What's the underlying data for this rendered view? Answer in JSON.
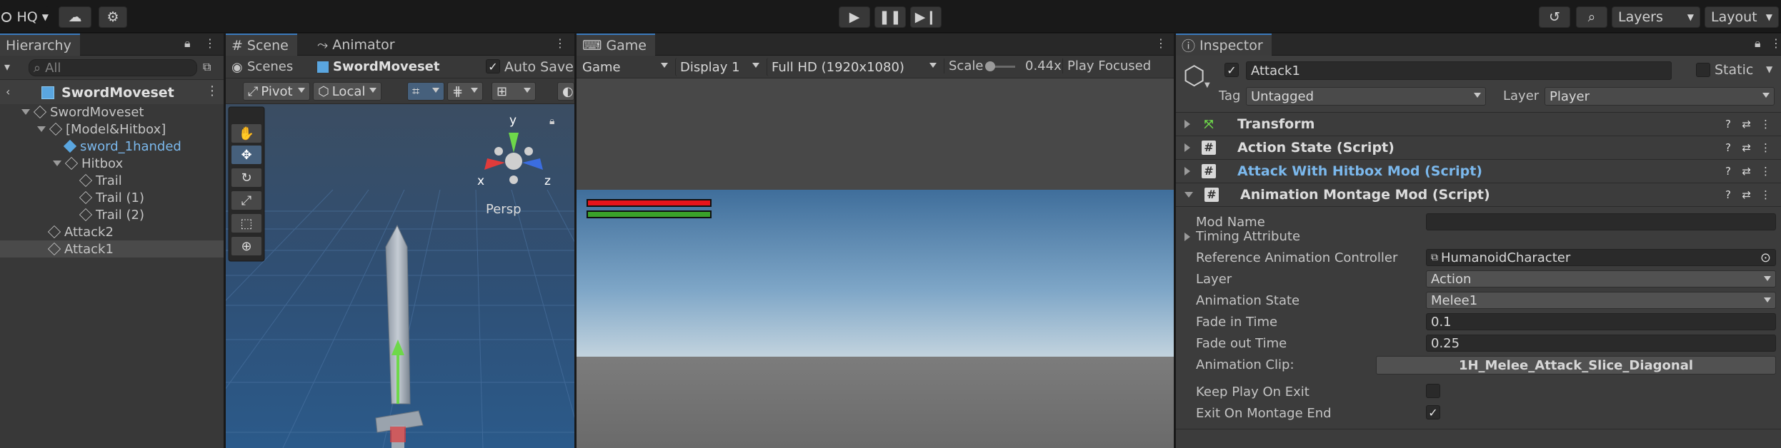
{
  "toolbar": {
    "account": "HQ",
    "layers": "Layers",
    "layout": "Layout"
  },
  "hierarchy": {
    "tab": "Hierarchy",
    "search_placeholder": "All",
    "root": "SwordMoveset",
    "items": [
      {
        "label": "SwordMoveset",
        "indent": 1
      },
      {
        "label": "[Model&Hitbox]",
        "indent": 2
      },
      {
        "label": "sword_1handed",
        "indent": 3
      },
      {
        "label": "Hitbox",
        "indent": 3
      },
      {
        "label": "Trail",
        "indent": 4
      },
      {
        "label": "Trail (1)",
        "indent": 4
      },
      {
        "label": "Trail (2)",
        "indent": 4
      },
      {
        "label": "Attack2",
        "indent": 2
      },
      {
        "label": "Attack1",
        "indent": 2
      }
    ]
  },
  "scene": {
    "tab_scene": "Scene",
    "tab_animator": "Animator",
    "breadcrumb_scenes": "Scenes",
    "breadcrumb_asset": "SwordMoveset",
    "auto_save": "Auto Save",
    "pivot": "Pivot",
    "local": "Local",
    "gizmo_y": "y",
    "gizmo_x": "x",
    "gizmo_z": "z",
    "persp": "Persp"
  },
  "game": {
    "tab": "Game",
    "mode": "Game",
    "display": "Display 1",
    "resolution": "Full HD (1920x1080)",
    "scale_label": "Scale",
    "scale_value": "0.44x",
    "play_focused": "Play Focused",
    "health_color": "#e8141b",
    "stamina_color": "#3aa12a"
  },
  "inspector": {
    "tab": "Inspector",
    "object_name": "Attack1",
    "static": "Static",
    "tag_label": "Tag",
    "tag_value": "Untagged",
    "layer_label": "Layer",
    "layer_value": "Player",
    "components": [
      {
        "name": "Transform",
        "highlight": false
      },
      {
        "name": "Action State (Script)",
        "highlight": false
      },
      {
        "name": "Attack With Hitbox Mod (Script)",
        "highlight": true
      },
      {
        "name": "Animation Montage Mod (Script)",
        "highlight": false
      }
    ],
    "fields": {
      "mod_name": "Mod Name",
      "timing_attribute": "Timing Attribute",
      "ref_anim_controller": "Reference Animation Controller",
      "ref_anim_controller_value": "HumanoidCharacter",
      "layer": "Layer",
      "layer_value": "Action",
      "animation_state": "Animation State",
      "animation_state_value": "Melee1",
      "fade_in": "Fade in Time",
      "fade_in_value": "0.1",
      "fade_out": "Fade out Time",
      "fade_out_value": "0.25",
      "animation_clip": "Animation Clip:",
      "animation_clip_value": "1H_Melee_Attack_Slice_Diagonal",
      "keep_play": "Keep Play On Exit",
      "exit_on_end": "Exit On Montage End"
    }
  }
}
